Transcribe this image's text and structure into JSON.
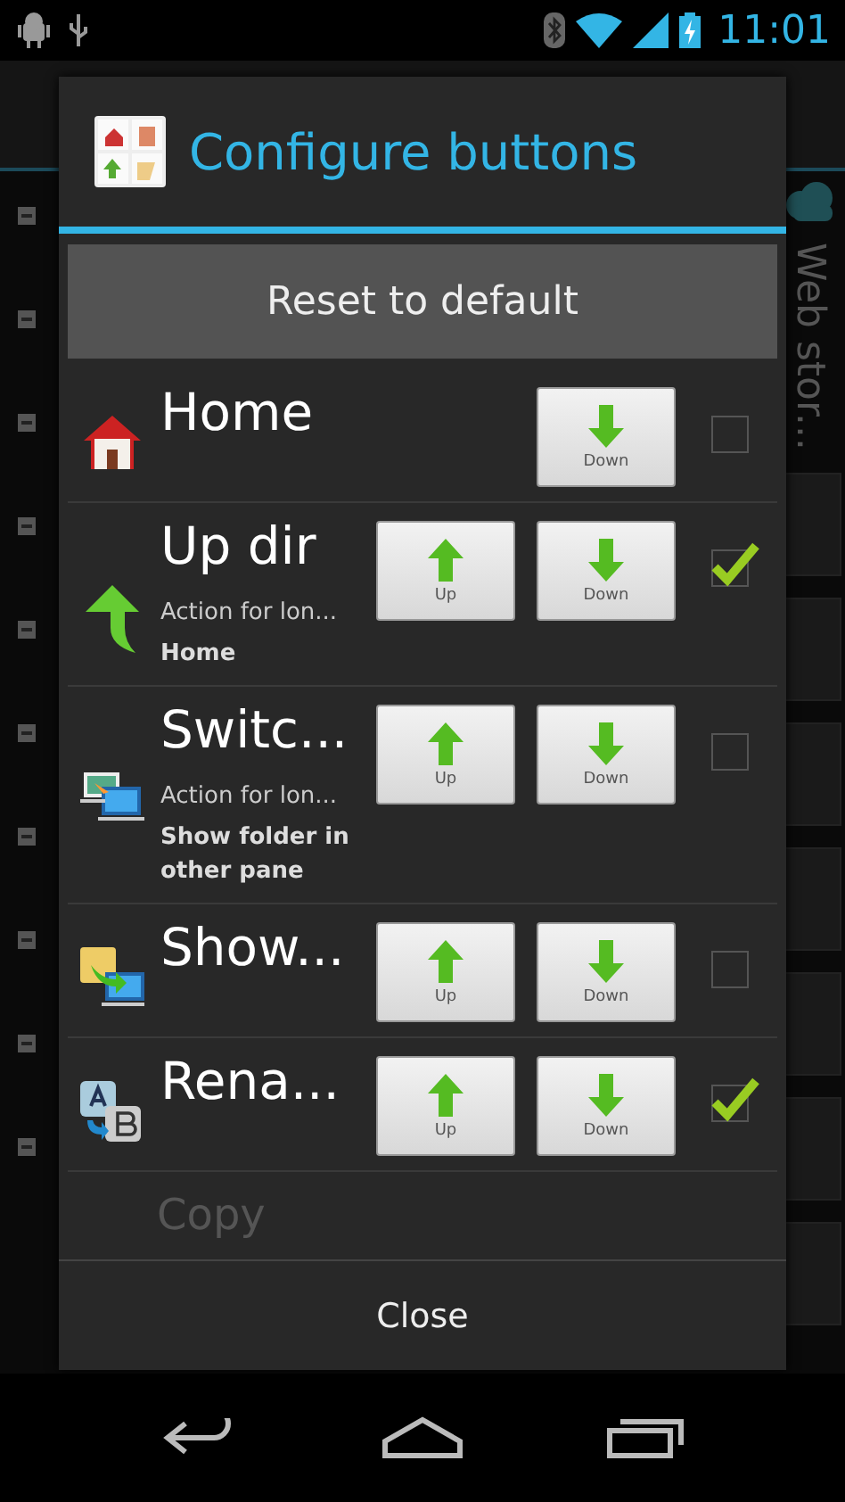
{
  "status_bar": {
    "time": "11:01"
  },
  "background": {
    "side_title": "Web stor..."
  },
  "dialog": {
    "title": "Configure buttons",
    "reset_button": "Reset to default",
    "rows": [
      {
        "kind": "home",
        "name": "Home",
        "up": null,
        "down": "Down",
        "checked": false
      },
      {
        "kind": "updir",
        "name": "Up dir",
        "up": "Up",
        "down": "Down",
        "checked": true,
        "long_label": "Action for lon...",
        "long_value": "Home"
      },
      {
        "kind": "switch",
        "name": "Switc...",
        "up": "Up",
        "down": "Down",
        "checked": false,
        "long_label": "Action for lon...",
        "long_value": "Show folder in other pane"
      },
      {
        "kind": "show",
        "name": "Show...",
        "up": "Up",
        "down": "Down",
        "checked": false
      },
      {
        "kind": "rename",
        "name": "Rena...",
        "up": "Up",
        "down": "Down",
        "checked": true
      }
    ],
    "partial_row": "Copy",
    "close_button": "Close"
  }
}
